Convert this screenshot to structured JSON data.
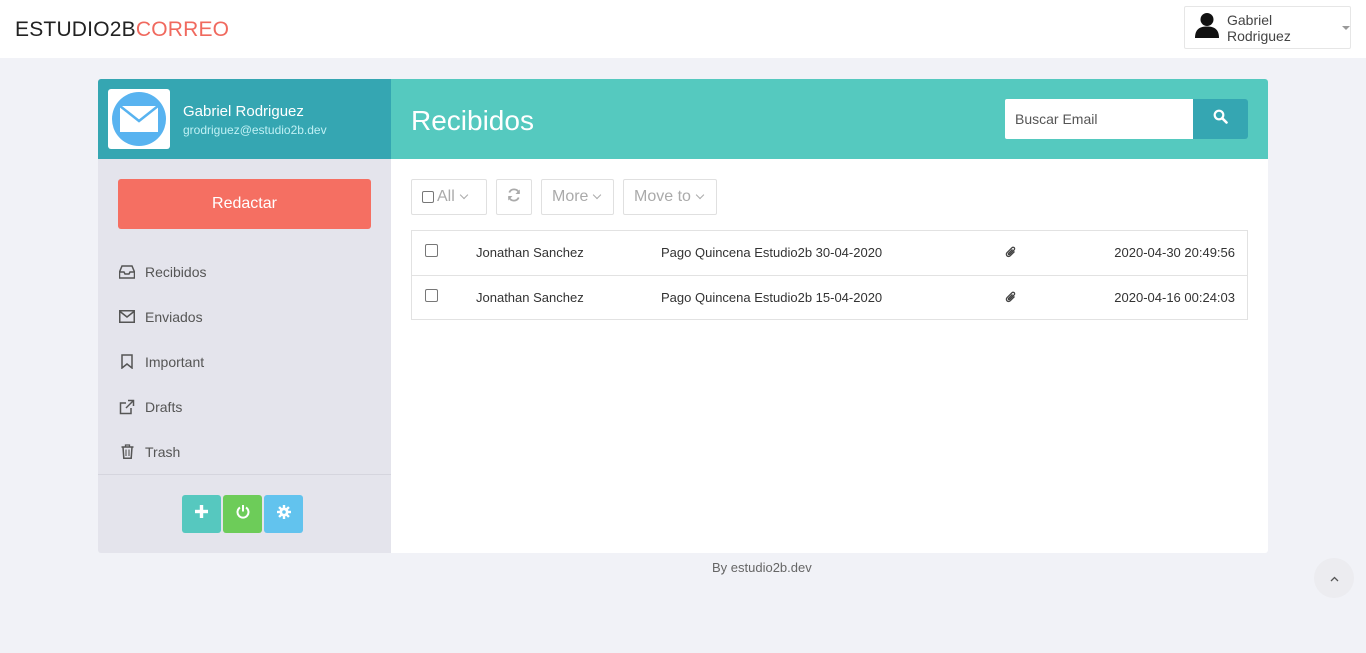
{
  "brand": {
    "part1": "ESTUDIO2B",
    "part2": "CORREO",
    "accent_color": "#f0695e"
  },
  "user_menu": {
    "name": "Gabriel Rodriguez",
    "icon": "user-icon"
  },
  "profile": {
    "name": "Gabriel Rodriguez",
    "email": "grodriguez@estudio2b.dev",
    "avatar_icon": "envelope-icon"
  },
  "compose_label": "Redactar",
  "nav": [
    {
      "label": "Recibidos",
      "icon": "inbox-icon"
    },
    {
      "label": "Enviados",
      "icon": "envelope-icon"
    },
    {
      "label": "Important",
      "icon": "bookmark-icon"
    },
    {
      "label": "Drafts",
      "icon": "external-link-icon"
    },
    {
      "label": "Trash",
      "icon": "trash-icon"
    }
  ],
  "sidebar_buttons": [
    "plus-icon",
    "power-icon",
    "gear-icon"
  ],
  "main": {
    "title": "Recibidos",
    "search_placeholder": "Buscar Email",
    "toolbar": {
      "all_label": "All",
      "more_label": "More",
      "move_label": "Move to"
    }
  },
  "emails": [
    {
      "from": "Jonathan Sanchez",
      "subject": "Pago Quincena Estudio2b 30-04-2020",
      "attachment": true,
      "date": "2020-04-30 20:49:56"
    },
    {
      "from": "Jonathan Sanchez",
      "subject": "Pago Quincena Estudio2b 15-04-2020",
      "attachment": true,
      "date": "2020-04-16 00:24:03"
    }
  ],
  "footer": "By estudio2b.dev",
  "colors": {
    "teal_dark": "#35a6b2",
    "teal": "#55c9bf",
    "compose": "#f56f62",
    "green": "#6dcc59",
    "blue": "#62c3ee"
  }
}
